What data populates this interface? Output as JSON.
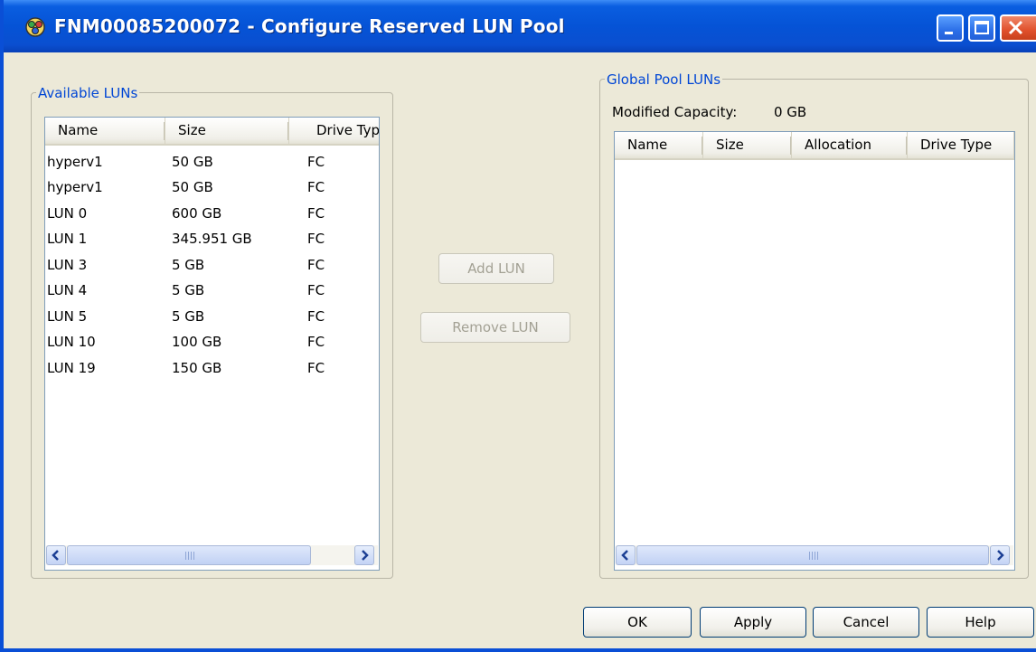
{
  "window": {
    "title": "FNM00085200072 - Configure Reserved LUN Pool",
    "colors": {
      "title_bar": "#0553d6",
      "group_label": "#0046d5",
      "dialog_bg": "#ece9d8",
      "close_button": "#e0502c"
    }
  },
  "available_luns": {
    "label": "Available LUNs",
    "columns": [
      "Name",
      "Size",
      "Drive Typ"
    ],
    "rows": [
      {
        "name": "hyperv1",
        "size": "50 GB",
        "drive_type": "FC"
      },
      {
        "name": "hyperv1",
        "size": "50 GB",
        "drive_type": "FC"
      },
      {
        "name": "LUN 0",
        "size": "600 GB",
        "drive_type": "FC"
      },
      {
        "name": "LUN 1",
        "size": "345.951 GB",
        "drive_type": "FC"
      },
      {
        "name": "LUN 3",
        "size": "5 GB",
        "drive_type": "FC"
      },
      {
        "name": "LUN 4",
        "size": "5 GB",
        "drive_type": "FC"
      },
      {
        "name": "LUN 5",
        "size": "5 GB",
        "drive_type": "FC"
      },
      {
        "name": "LUN 10",
        "size": "100 GB",
        "drive_type": "FC"
      },
      {
        "name": "LUN 19",
        "size": "150 GB",
        "drive_type": "FC"
      }
    ]
  },
  "actions": {
    "add_lun": "Add LUN",
    "remove_lun": "Remove LUN"
  },
  "global_pool": {
    "label": "Global Pool LUNs",
    "modified_capacity_label": "Modified Capacity:",
    "modified_capacity_value": "0 GB",
    "columns": [
      "Name",
      "Size",
      "Allocation",
      "Drive Type"
    ],
    "rows": []
  },
  "footer": {
    "ok": "OK",
    "apply": "Apply",
    "cancel": "Cancel",
    "help": "Help"
  }
}
